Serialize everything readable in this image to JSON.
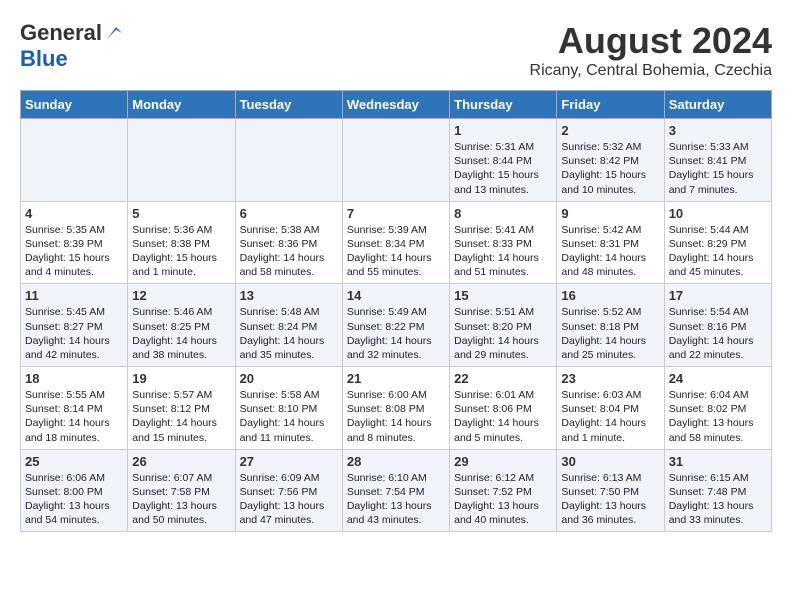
{
  "logo": {
    "general": "General",
    "blue": "Blue"
  },
  "title": "August 2024",
  "location": "Ricany, Central Bohemia, Czechia",
  "headers": [
    "Sunday",
    "Monday",
    "Tuesday",
    "Wednesday",
    "Thursday",
    "Friday",
    "Saturday"
  ],
  "weeks": [
    [
      {
        "day": "",
        "info": ""
      },
      {
        "day": "",
        "info": ""
      },
      {
        "day": "",
        "info": ""
      },
      {
        "day": "",
        "info": ""
      },
      {
        "day": "1",
        "info": "Sunrise: 5:31 AM\nSunset: 8:44 PM\nDaylight: 15 hours\nand 13 minutes."
      },
      {
        "day": "2",
        "info": "Sunrise: 5:32 AM\nSunset: 8:42 PM\nDaylight: 15 hours\nand 10 minutes."
      },
      {
        "day": "3",
        "info": "Sunrise: 5:33 AM\nSunset: 8:41 PM\nDaylight: 15 hours\nand 7 minutes."
      }
    ],
    [
      {
        "day": "4",
        "info": "Sunrise: 5:35 AM\nSunset: 8:39 PM\nDaylight: 15 hours\nand 4 minutes."
      },
      {
        "day": "5",
        "info": "Sunrise: 5:36 AM\nSunset: 8:38 PM\nDaylight: 15 hours\nand 1 minute."
      },
      {
        "day": "6",
        "info": "Sunrise: 5:38 AM\nSunset: 8:36 PM\nDaylight: 14 hours\nand 58 minutes."
      },
      {
        "day": "7",
        "info": "Sunrise: 5:39 AM\nSunset: 8:34 PM\nDaylight: 14 hours\nand 55 minutes."
      },
      {
        "day": "8",
        "info": "Sunrise: 5:41 AM\nSunset: 8:33 PM\nDaylight: 14 hours\nand 51 minutes."
      },
      {
        "day": "9",
        "info": "Sunrise: 5:42 AM\nSunset: 8:31 PM\nDaylight: 14 hours\nand 48 minutes."
      },
      {
        "day": "10",
        "info": "Sunrise: 5:44 AM\nSunset: 8:29 PM\nDaylight: 14 hours\nand 45 minutes."
      }
    ],
    [
      {
        "day": "11",
        "info": "Sunrise: 5:45 AM\nSunset: 8:27 PM\nDaylight: 14 hours\nand 42 minutes."
      },
      {
        "day": "12",
        "info": "Sunrise: 5:46 AM\nSunset: 8:25 PM\nDaylight: 14 hours\nand 38 minutes."
      },
      {
        "day": "13",
        "info": "Sunrise: 5:48 AM\nSunset: 8:24 PM\nDaylight: 14 hours\nand 35 minutes."
      },
      {
        "day": "14",
        "info": "Sunrise: 5:49 AM\nSunset: 8:22 PM\nDaylight: 14 hours\nand 32 minutes."
      },
      {
        "day": "15",
        "info": "Sunrise: 5:51 AM\nSunset: 8:20 PM\nDaylight: 14 hours\nand 29 minutes."
      },
      {
        "day": "16",
        "info": "Sunrise: 5:52 AM\nSunset: 8:18 PM\nDaylight: 14 hours\nand 25 minutes."
      },
      {
        "day": "17",
        "info": "Sunrise: 5:54 AM\nSunset: 8:16 PM\nDaylight: 14 hours\nand 22 minutes."
      }
    ],
    [
      {
        "day": "18",
        "info": "Sunrise: 5:55 AM\nSunset: 8:14 PM\nDaylight: 14 hours\nand 18 minutes."
      },
      {
        "day": "19",
        "info": "Sunrise: 5:57 AM\nSunset: 8:12 PM\nDaylight: 14 hours\nand 15 minutes."
      },
      {
        "day": "20",
        "info": "Sunrise: 5:58 AM\nSunset: 8:10 PM\nDaylight: 14 hours\nand 11 minutes."
      },
      {
        "day": "21",
        "info": "Sunrise: 6:00 AM\nSunset: 8:08 PM\nDaylight: 14 hours\nand 8 minutes."
      },
      {
        "day": "22",
        "info": "Sunrise: 6:01 AM\nSunset: 8:06 PM\nDaylight: 14 hours\nand 5 minutes."
      },
      {
        "day": "23",
        "info": "Sunrise: 6:03 AM\nSunset: 8:04 PM\nDaylight: 14 hours\nand 1 minute."
      },
      {
        "day": "24",
        "info": "Sunrise: 6:04 AM\nSunset: 8:02 PM\nDaylight: 13 hours\nand 58 minutes."
      }
    ],
    [
      {
        "day": "25",
        "info": "Sunrise: 6:06 AM\nSunset: 8:00 PM\nDaylight: 13 hours\nand 54 minutes."
      },
      {
        "day": "26",
        "info": "Sunrise: 6:07 AM\nSunset: 7:58 PM\nDaylight: 13 hours\nand 50 minutes."
      },
      {
        "day": "27",
        "info": "Sunrise: 6:09 AM\nSunset: 7:56 PM\nDaylight: 13 hours\nand 47 minutes."
      },
      {
        "day": "28",
        "info": "Sunrise: 6:10 AM\nSunset: 7:54 PM\nDaylight: 13 hours\nand 43 minutes."
      },
      {
        "day": "29",
        "info": "Sunrise: 6:12 AM\nSunset: 7:52 PM\nDaylight: 13 hours\nand 40 minutes."
      },
      {
        "day": "30",
        "info": "Sunrise: 6:13 AM\nSunset: 7:50 PM\nDaylight: 13 hours\nand 36 minutes."
      },
      {
        "day": "31",
        "info": "Sunrise: 6:15 AM\nSunset: 7:48 PM\nDaylight: 13 hours\nand 33 minutes."
      }
    ]
  ]
}
